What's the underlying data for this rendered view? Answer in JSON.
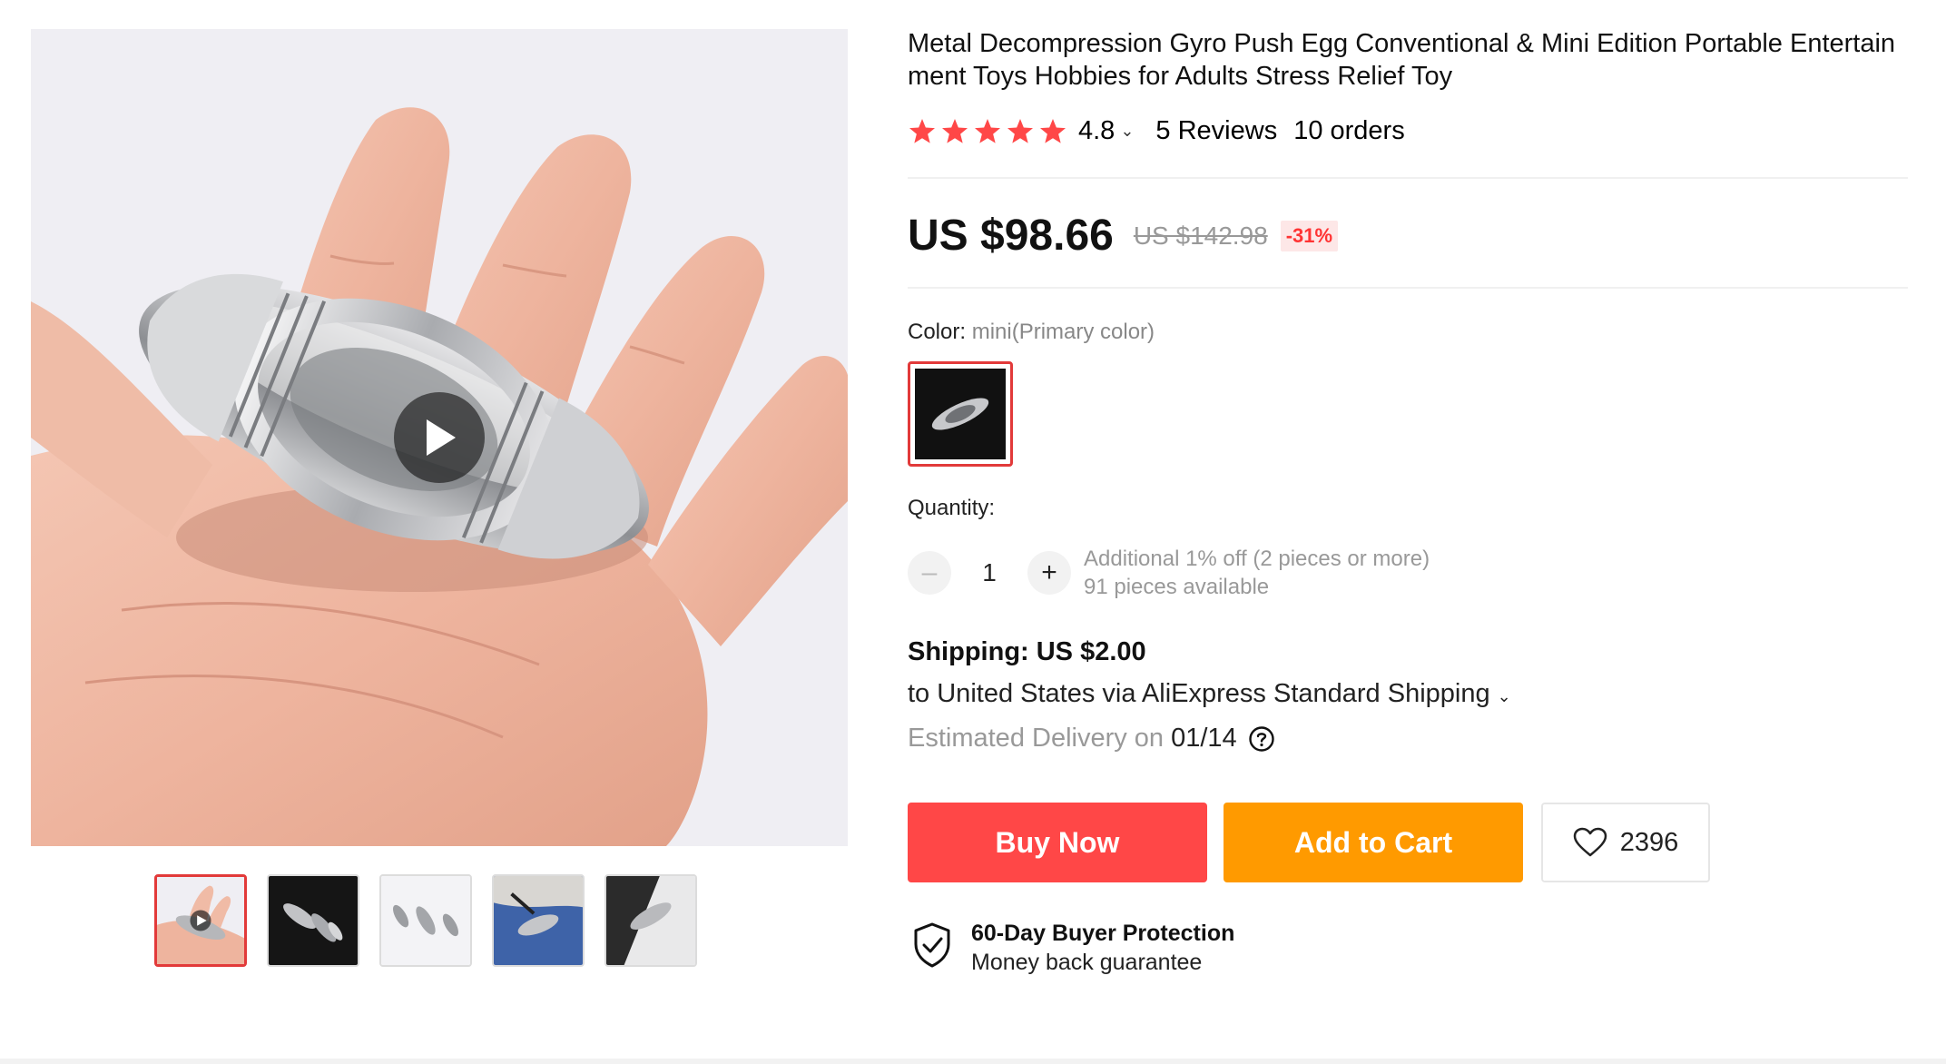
{
  "product": {
    "title": "Metal Decompression Gyro Push Egg Conventional & Mini Edition Portable Entertainment Toys Hobbies for Adults Stress Relief Toy",
    "rating": {
      "stars": 5,
      "value": "4.8",
      "reviews": "5 Reviews",
      "orders": "10 orders"
    },
    "price": {
      "current": "US $98.66",
      "original": "US $142.98",
      "discount": "-31%"
    },
    "color": {
      "label": "Color:",
      "selected": "mini(Primary color)"
    },
    "quantity": {
      "label": "Quantity:",
      "value": "1",
      "minus_symbol": "–",
      "plus_symbol": "+",
      "discount_note": "Additional 1% off (2 pieces or more)",
      "available": "91 pieces available"
    },
    "shipping": {
      "title": "Shipping: US $2.00",
      "destination": "to United States via AliExpress Standard Shipping",
      "delivery_label": "Estimated Delivery on",
      "delivery_date": "01/14"
    },
    "actions": {
      "buy_now": "Buy Now",
      "add_to_cart": "Add to Cart",
      "wishlist_count": "2396"
    },
    "protection": {
      "title": "60-Day Buyer Protection",
      "subtitle": "Money back guarantee"
    }
  },
  "gallery": {
    "selected_index": 0,
    "thumbnails": [
      {
        "icon": "hand-with-toy-video"
      },
      {
        "icon": "toys-on-black"
      },
      {
        "icon": "three-toys-white"
      },
      {
        "icon": "toy-on-blue-cloth"
      },
      {
        "icon": "toy-on-stand"
      }
    ]
  },
  "colors": {
    "star": "#ff4747",
    "buy_now": "#ff4747",
    "add_to_cart": "#ff9a00",
    "selected_border": "#e23a3a"
  },
  "icons": {
    "play": "play-icon",
    "heart": "heart-icon",
    "shield": "shield-check-icon",
    "help": "question-circle-icon",
    "chevron": "chevron-down-icon"
  }
}
